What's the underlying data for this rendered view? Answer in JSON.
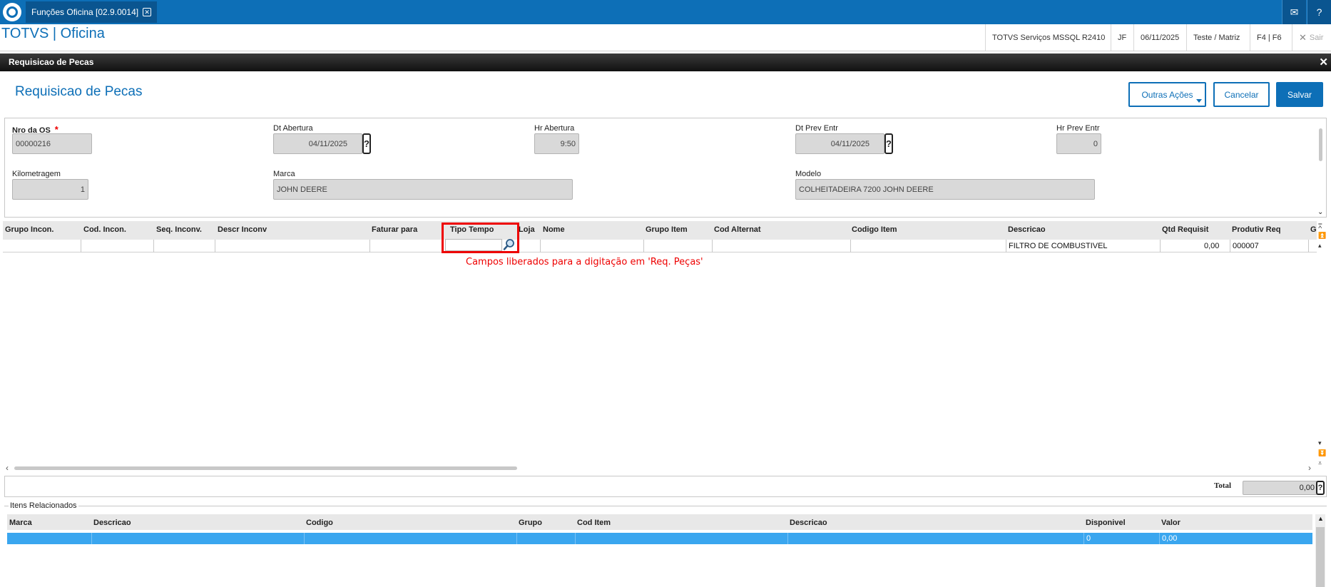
{
  "tab": {
    "title": "Funções Oficina [02.9.0014]"
  },
  "header": {
    "app_title": "TOTVS | Oficina",
    "server": "TOTVS Serviços MSSQL R2410",
    "user": "JF",
    "date": "06/11/2025",
    "company": "Teste / Matriz",
    "keys": "F4 | F6",
    "exit": "Sair"
  },
  "dialog": {
    "bar_title": "Requisicao de Pecas",
    "title": "Requisicao de Pecas",
    "btn_other": "Outras Ações",
    "btn_cancel": "Cancelar",
    "btn_save": "Salvar"
  },
  "form": {
    "nro_os_label": "Nro da OS",
    "nro_os": "00000216",
    "dt_abertura_label": "Dt Abertura",
    "dt_abertura": "04/11/2025",
    "hr_abertura_label": "Hr Abertura",
    "hr_abertura": "9:50",
    "dt_prev_label": "Dt Prev Entr",
    "dt_prev": "04/11/2025",
    "hr_prev_label": "Hr Prev Entr",
    "hr_prev": "0",
    "km_label": "Kilometragem",
    "km": "1",
    "marca_label": "Marca",
    "marca": "JOHN DEERE",
    "modelo_label": "Modelo",
    "modelo": "COLHEITADEIRA 7200  JOHN DEERE",
    "help": "?"
  },
  "grid": {
    "columns": [
      "Grupo Incon.",
      "Cod. Incon.",
      "Seq. Inconv.",
      "Descr Inconv",
      "Faturar para",
      "Tipo Tempo",
      "Loja",
      "Nome",
      "Grupo Item",
      "Cod Alternat",
      "Codigo Item",
      "Descricao",
      "Qtd Requisit",
      "Produtiv Req",
      "G"
    ],
    "row": {
      "descricao": "FILTRO DE COMBUSTIVEL",
      "qtd": "0,00",
      "produtiv": "000007"
    },
    "annotation": "Campos liberados para a digitação em 'Req. Peças'"
  },
  "total": {
    "label": "Total",
    "value": "0,00"
  },
  "related": {
    "legend": "Itens Relacionados",
    "columns": [
      "Marca",
      "Descricao",
      "Codigo",
      "Grupo",
      "Cod Item",
      "Descricao",
      "Disponivel",
      "Valor"
    ],
    "row": {
      "disponivel": "0",
      "valor": "0,00"
    }
  }
}
